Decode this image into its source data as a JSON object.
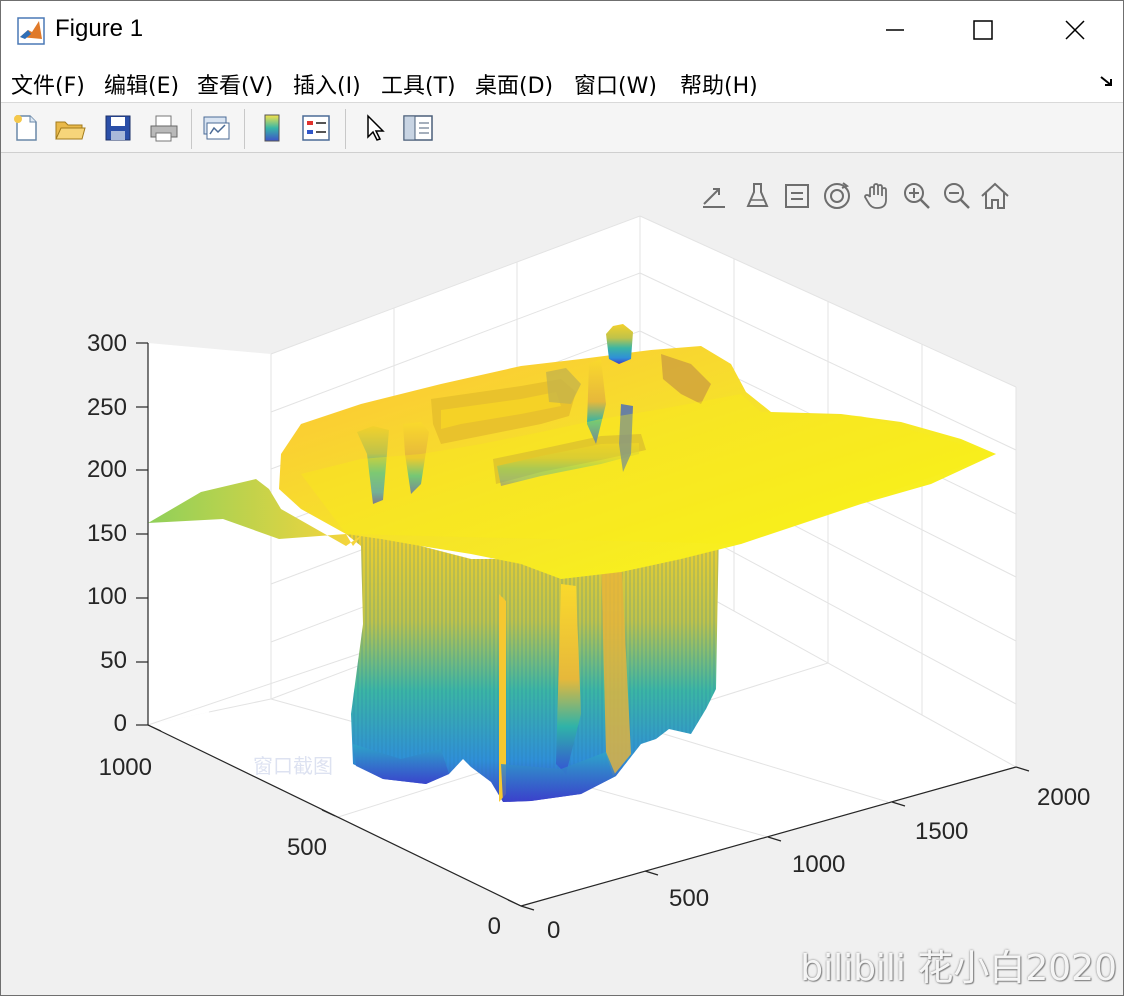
{
  "window": {
    "title": "Figure 1"
  },
  "menu": {
    "items": [
      "文件(F)",
      "编辑(E)",
      "查看(V)",
      "插入(I)",
      "工具(T)",
      "桌面(D)",
      "窗口(W)",
      "帮助(H)"
    ]
  },
  "toolbar": {
    "items": [
      "new-figure-icon",
      "open-file-icon",
      "save-icon",
      "print-icon",
      "link-plot-icon",
      "colorbar-icon",
      "legend-icon",
      "pointer-icon",
      "property-inspector-icon"
    ]
  },
  "axes_toolbar": {
    "items": [
      "export-icon",
      "brush-icon",
      "datatip-icon",
      "rotate-3d-icon",
      "pan-icon",
      "zoom-in-icon",
      "zoom-out-icon",
      "home-icon"
    ]
  },
  "overlay_text": "窗口截图",
  "watermark": "bilibili 花小白2020",
  "colors": {
    "surface_top": "#f7f719",
    "surface_mid": "#fdbc3c",
    "surface_teal": "#2bb09a",
    "surface_blue": "#3e4cd6"
  },
  "chart_data": {
    "type": "surface",
    "x_ticks": [
      "0",
      "500",
      "1000",
      "1500",
      "2000"
    ],
    "y_ticks": [
      "0",
      "500",
      "1000"
    ],
    "z_ticks": [
      "0",
      "50",
      "100",
      "150",
      "200",
      "250",
      "300"
    ],
    "xlim": [
      0,
      2000
    ],
    "ylim": [
      0,
      1000
    ],
    "zlim": [
      0,
      300
    ],
    "grid": true,
    "colormap": "parula"
  }
}
